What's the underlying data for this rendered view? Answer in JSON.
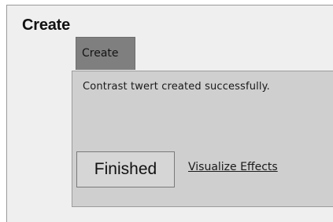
{
  "page": {
    "title": "Create"
  },
  "dialog": {
    "tab_label": "Create",
    "message": "Contrast twert created successfully.",
    "finished_button_label": "Finished",
    "visualize_link_label": "Visualize Effects"
  },
  "colors": {
    "page_background": "#efefef",
    "dialog_background": "#cfcfcf",
    "tab_background": "#7f7f7f"
  }
}
